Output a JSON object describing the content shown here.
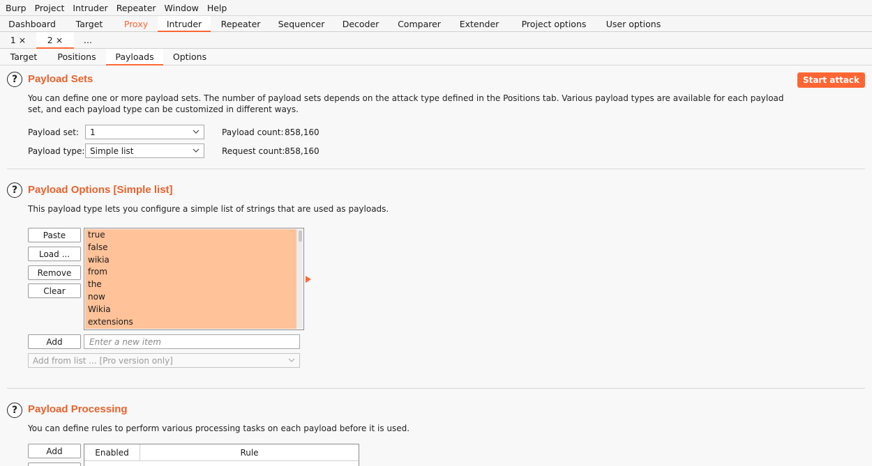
{
  "menu": [
    "Burp",
    "Project",
    "Intruder",
    "Repeater",
    "Window",
    "Help"
  ],
  "main_tabs": [
    "Dashboard",
    "Target",
    "Proxy",
    "Intruder",
    "Repeater",
    "Sequencer",
    "Decoder",
    "Comparer",
    "Extender",
    "Project options",
    "User options"
  ],
  "sub_tabs": [
    "1 ×",
    "2 ×",
    "..."
  ],
  "page_tabs": [
    "Target",
    "Positions",
    "Payloads",
    "Options"
  ],
  "payload_sets": {
    "title": "Payload Sets",
    "start_attack": "Start attack",
    "description": "You can define one or more payload sets. The number of payload sets depends on the attack type defined in the Positions tab. Various payload types are available for each payload set, and each payload type can be customized in different ways.",
    "set_label": "Payload set:",
    "set_value": "1",
    "type_label": "Payload type:",
    "type_value": "Simple list",
    "payload_count_label": "Payload count:",
    "payload_count": "858,160",
    "request_count_label": "Request count:",
    "request_count": "858,160"
  },
  "payload_options": {
    "title": "Payload Options [Simple list]",
    "description": "This payload type lets you configure a simple list of strings that are used as payloads.",
    "buttons": {
      "paste": "Paste",
      "load": "Load ...",
      "remove": "Remove",
      "clear": "Clear",
      "add": "Add"
    },
    "items": [
      "true",
      "false",
      "wikia",
      "from",
      "the",
      "now",
      "Wikia",
      "extensions"
    ],
    "new_item_placeholder": "Enter a new item",
    "add_from_list": "Add from list ... [Pro version only]"
  },
  "payload_processing": {
    "title": "Payload Processing",
    "description": "You can define rules to perform various processing tasks on each payload before it is used.",
    "add": "Add",
    "columns": [
      "Enabled",
      "Rule"
    ]
  },
  "colors": {
    "accent": "#ff6633",
    "list_highlight": "#ffc299"
  }
}
